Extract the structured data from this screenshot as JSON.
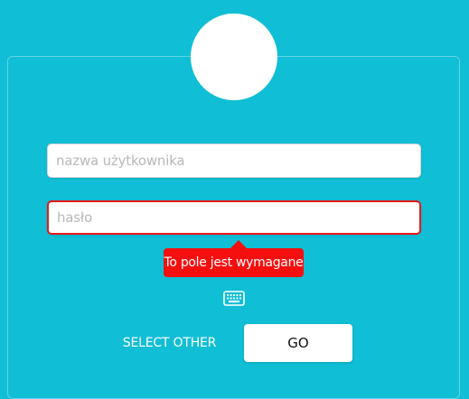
{
  "login": {
    "username_placeholder": "nazwa użytkownika",
    "username_value": "",
    "password_placeholder": "hasło",
    "password_value": "",
    "error_message": "To pole jest wymagane",
    "select_other_label": "SELECT OTHER",
    "go_label": "GO"
  },
  "icons": {
    "avatar": "user-avatar",
    "keyboard": "keyboard-icon"
  },
  "colors": {
    "background": "#10bed5",
    "error": "#f50f0f",
    "button_bg": "#ffffff"
  }
}
